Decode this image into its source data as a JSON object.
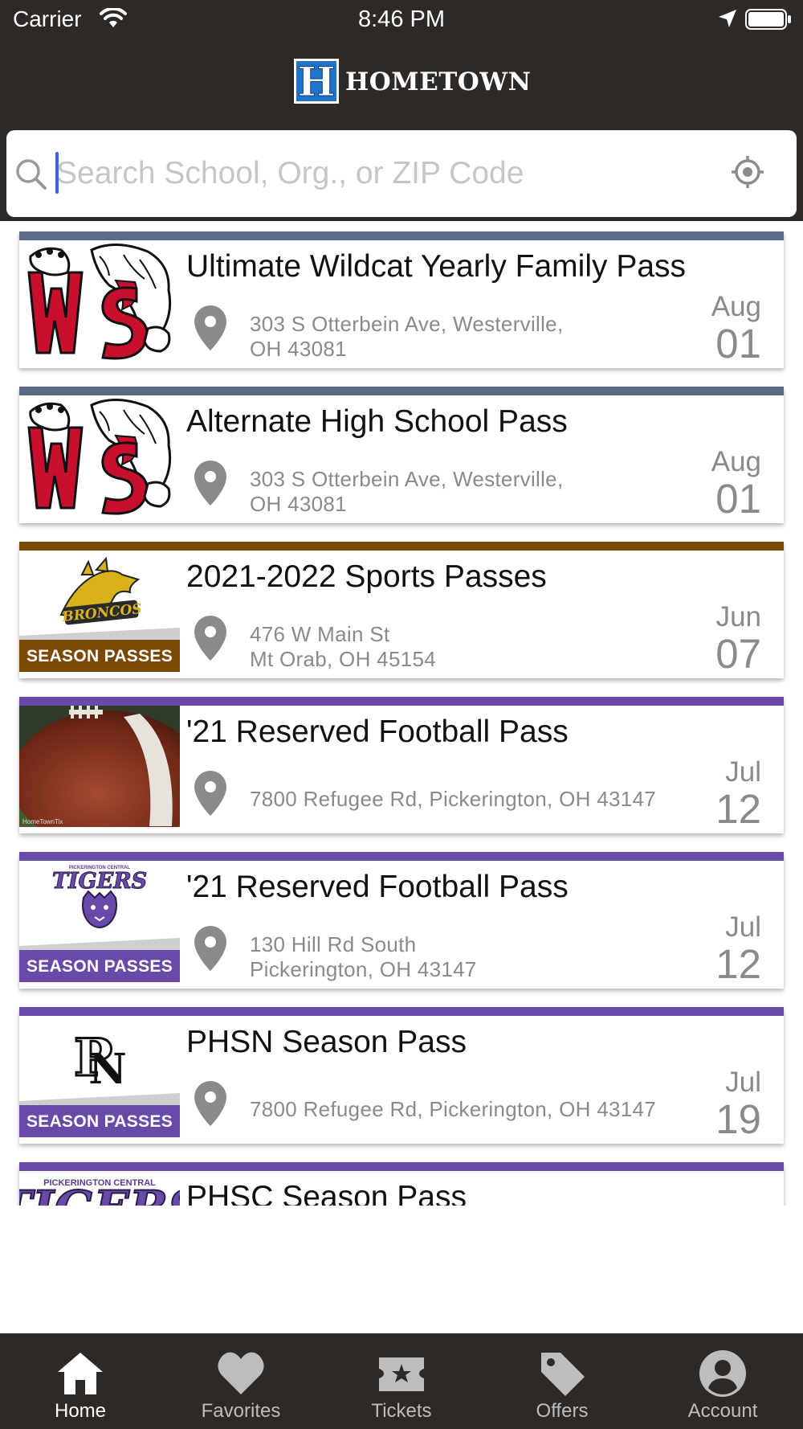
{
  "status_bar": {
    "carrier": "Carrier",
    "time": "8:46 PM"
  },
  "app": {
    "logo_letter": "H",
    "logo_text": "HOMETOWN"
  },
  "search": {
    "placeholder": "Search School, Org., or ZIP Code",
    "value": ""
  },
  "colors": {
    "header_bg": "#2c2927",
    "logo_blue": "#1f74c9",
    "bar_slate": "#5c6b85",
    "bar_brown": "#7a4a05",
    "bar_purple": "#6a4aa8"
  },
  "passes": [
    {
      "title": "Ultimate Wildcat Yearly Family  Pass",
      "address_line1": "303 S Otterbein Ave, Westerville,",
      "address_line2": "OH 43081",
      "month": "Aug",
      "day": "01",
      "thumb": "ws-wildcat-logo",
      "bar_color": "#5c6b85"
    },
    {
      "title": "Alternate High School Pass",
      "address_line1": "303 S Otterbein Ave, Westerville,",
      "address_line2": "OH 43081",
      "month": "Aug",
      "day": "01",
      "thumb": "ws-wildcat-logo",
      "bar_color": "#5c6b85"
    },
    {
      "title": "2021-2022 Sports Passes",
      "address_line1": "476 W Main St",
      "address_line2": "Mt Orab, OH 45154",
      "month": "Jun",
      "day": "07",
      "thumb": "broncos-season-passes",
      "badge": "SEASON PASSES",
      "bar_color": "#7a4a05"
    },
    {
      "title": "'21 Reserved Football Pass",
      "address_line1": "7800 Refugee Rd, Pickerington, OH 43147",
      "address_line2": "",
      "month": "Jul",
      "day": "12",
      "thumb": "football-photo",
      "watermark": "HomeTownTix",
      "bar_color": "#6a4aa8"
    },
    {
      "title": "'21 Reserved Football Pass",
      "address_line1": "130 Hill Rd South",
      "address_line2": "Pickerington, OH 43147",
      "month": "Jul",
      "day": "12",
      "thumb": "tigers-season-passes",
      "thumb_caption": "PICKERINGTON CENTRAL",
      "thumb_logo_text": "TIGERS",
      "badge": "SEASON PASSES",
      "bar_color": "#6a4aa8"
    },
    {
      "title": "PHSN Season Pass",
      "address_line1": "7800 Refugee Rd, Pickerington, OH 43147",
      "address_line2": "",
      "month": "Jul",
      "day": "19",
      "thumb": "pn-season-passes",
      "badge": "SEASON PASSES",
      "bar_color": "#6a4aa8"
    },
    {
      "title": "PHSC Season Pass",
      "address_line1": "",
      "address_line2": "",
      "month": "",
      "day": "",
      "thumb": "tigers-wordmark",
      "thumb_caption": "PICKERINGTON CENTRAL",
      "thumb_logo_text": "TIGERS",
      "bar_color": "#6a4aa8"
    }
  ],
  "tabs": [
    {
      "label": "Home",
      "icon": "home-icon",
      "active": true
    },
    {
      "label": "Favorites",
      "icon": "heart-icon",
      "active": false
    },
    {
      "label": "Tickets",
      "icon": "ticket-icon",
      "active": false
    },
    {
      "label": "Offers",
      "icon": "tag-icon",
      "active": false
    },
    {
      "label": "Account",
      "icon": "account-icon",
      "active": false
    }
  ]
}
